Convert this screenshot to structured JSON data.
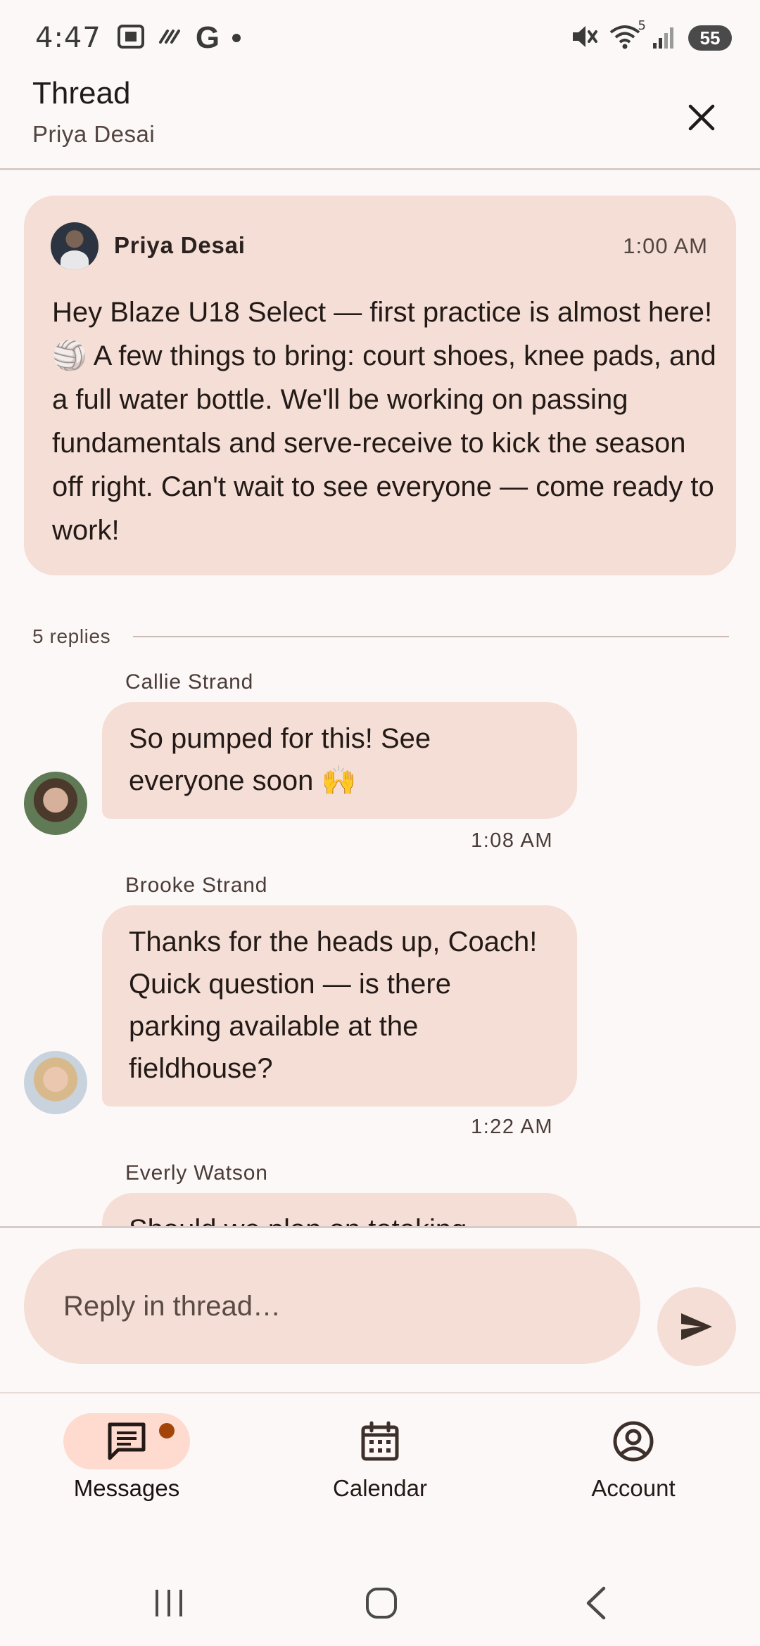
{
  "status_bar": {
    "time": "4:47",
    "left_icons": [
      "screenshot-icon",
      "signal-off-icon",
      "google-icon",
      "notification-dot-icon"
    ],
    "google_letter": "G",
    "right_icons": [
      "mute-icon",
      "wifi-icon",
      "cell-signal-icon"
    ],
    "wifi_label": "5",
    "battery": "55"
  },
  "header": {
    "title": "Thread",
    "subtitle": "Priya Desai",
    "close_icon": "close-icon"
  },
  "parent_message": {
    "author": "Priya Desai",
    "time": "1:00 AM",
    "body": "Hey Blaze U18 Select — first practice is almost here! 🏐 A few things to bring: court shoes, knee pads, and a full water bottle. We'll be working on passing fundamentals and serve-receive to kick the season off right. Can't wait to see everyone — come ready to work!"
  },
  "replies_header": {
    "count_label": "5 replies"
  },
  "replies": [
    {
      "author": "Callie Strand",
      "text": "So pumped for this! See everyone soon 🙌",
      "time": "1:08 AM"
    },
    {
      "author": "Brooke Strand",
      "text": "Thanks for the heads up, Coach! Quick question — is there parking available at the fieldhouse?",
      "time": "1:22 AM"
    },
    {
      "author": "Everly Watson",
      "text": "Should we plan on totaking"
    }
  ],
  "composer": {
    "placeholder": "Reply in thread…",
    "send_icon": "send-icon"
  },
  "bottom_nav": {
    "items": [
      {
        "label": "Messages",
        "icon": "chat-icon",
        "active": true,
        "badge": true
      },
      {
        "label": "Calendar",
        "icon": "calendar-icon",
        "active": false
      },
      {
        "label": "Account",
        "icon": "account-icon",
        "active": false
      }
    ]
  },
  "system_nav": {
    "buttons": [
      "recents-icon",
      "home-icon",
      "back-icon"
    ]
  },
  "colors": {
    "bubble": "#f4ded5",
    "background": "#fdf8f8",
    "active_nav": "#ffdbcf",
    "badge": "#a3440a"
  }
}
